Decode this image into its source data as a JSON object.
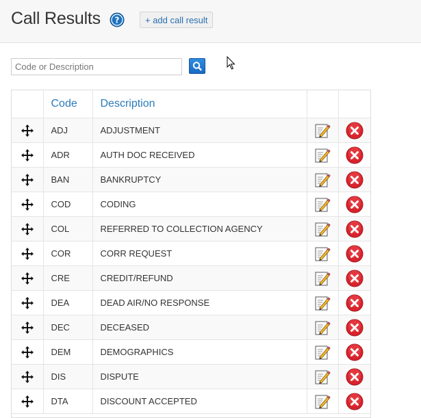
{
  "header": {
    "title": "Call Results",
    "add_label": "+ add call result"
  },
  "search": {
    "placeholder": "Code or Description"
  },
  "table": {
    "columns": {
      "code": "Code",
      "description": "Description"
    },
    "rows": [
      {
        "code": "ADJ",
        "description": "ADJUSTMENT"
      },
      {
        "code": "ADR",
        "description": "AUTH DOC RECEIVED"
      },
      {
        "code": "BAN",
        "description": "BANKRUPTCY"
      },
      {
        "code": "COD",
        "description": "CODING"
      },
      {
        "code": "COL",
        "description": "REFERRED TO COLLECTION AGENCY"
      },
      {
        "code": "COR",
        "description": "CORR REQUEST"
      },
      {
        "code": "CRE",
        "description": "CREDIT/REFUND"
      },
      {
        "code": "DEA",
        "description": "DEAD AIR/NO RESPONSE"
      },
      {
        "code": "DEC",
        "description": "DECEASED"
      },
      {
        "code": "DEM",
        "description": "DEMOGRAPHICS"
      },
      {
        "code": "DIS",
        "description": "DISPUTE"
      },
      {
        "code": "DTA",
        "description": "DISCOUNT ACCEPTED"
      }
    ]
  },
  "icons": {
    "help": "help-icon",
    "search": "search-icon",
    "move": "move-icon",
    "edit": "edit-icon",
    "delete": "delete-icon",
    "cursor": "mouse-cursor-icon"
  },
  "colors": {
    "accent": "#2a7ab8",
    "help_blue": "#1e73be",
    "delete_red": "#d9232d",
    "search_blue": "#2f8de0"
  }
}
